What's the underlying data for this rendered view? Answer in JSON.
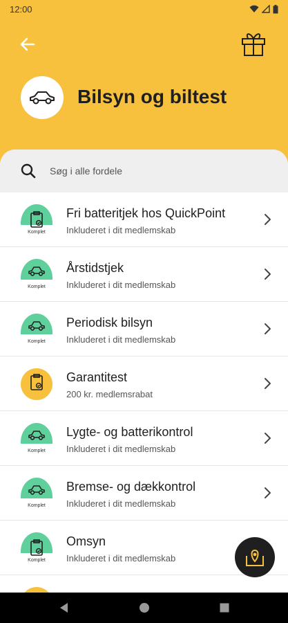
{
  "status_bar": {
    "time": "12:00"
  },
  "header": {
    "title": "Bilsyn og biltest"
  },
  "search": {
    "placeholder": "Søg i alle fordele"
  },
  "items": [
    {
      "title": "Fri batteritjek hos QuickPoint",
      "subtitle": "Inkluderet i dit medlemskab",
      "badge_type": "komplet",
      "badge_label": "Komplet",
      "icon": "clipboard-icon"
    },
    {
      "title": "Årstidstjek",
      "subtitle": "Inkluderet i dit medlemskab",
      "badge_type": "komplet",
      "badge_label": "Komplet",
      "icon": "car-icon"
    },
    {
      "title": "Periodisk bilsyn",
      "subtitle": "Inkluderet i dit medlemskab",
      "badge_type": "komplet",
      "badge_label": "Komplet",
      "icon": "car-icon"
    },
    {
      "title": "Garantitest",
      "subtitle": "200 kr. medlemsrabat",
      "badge_type": "discount",
      "badge_label": "",
      "icon": "clipboard-icon"
    },
    {
      "title": "Lygte- og batterikontrol",
      "subtitle": "Inkluderet i dit medlemskab",
      "badge_type": "komplet",
      "badge_label": "Komplet",
      "icon": "car-icon"
    },
    {
      "title": "Bremse- og dækkontrol",
      "subtitle": "Inkluderet i dit medlemskab",
      "badge_type": "komplet",
      "badge_label": "Komplet",
      "icon": "car-icon"
    },
    {
      "title": "Omsyn",
      "subtitle": "Inkluderet i dit medlemskab",
      "badge_type": "komplet",
      "badge_label": "Komplet",
      "icon": "clipboard-icon"
    }
  ],
  "colors": {
    "accent": "#f7c13e",
    "komplet_badge": "#5fcf9b",
    "fab": "#1f1f1f"
  }
}
